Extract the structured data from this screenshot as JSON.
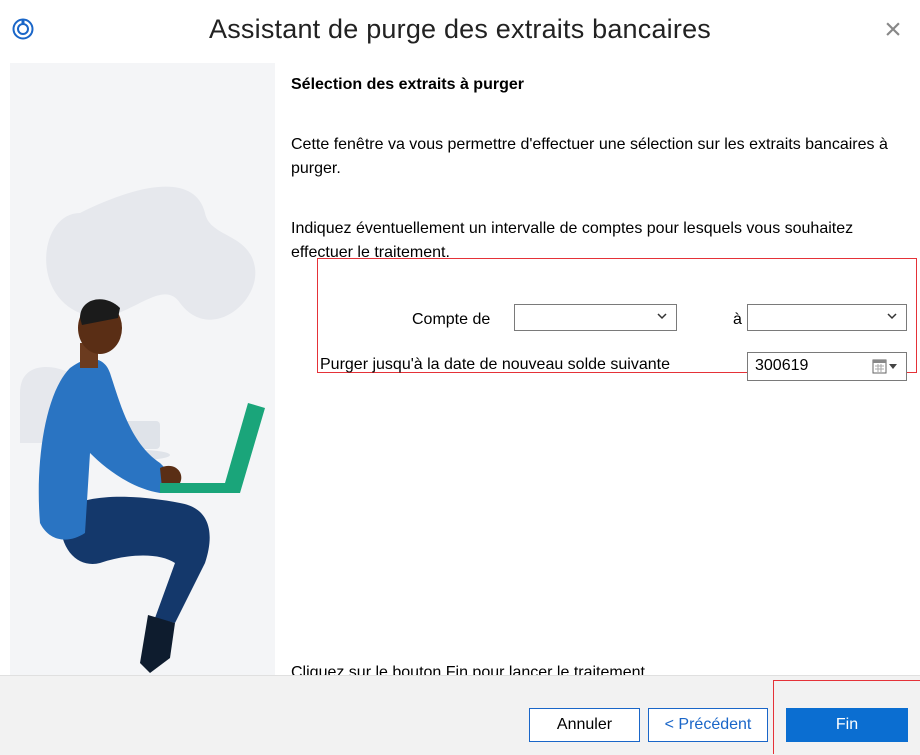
{
  "window": {
    "title": "Assistant de purge des extraits bancaires",
    "close_symbol": "×",
    "app_icon": "app-logo-icon",
    "close_icon": "close-icon"
  },
  "content": {
    "heading": "Sélection des extraits à purger",
    "intro": "Cette fenêtre va vous permettre d'effectuer une sélection sur les extraits bancaires à purger.",
    "instruction": "Indiquez éventuellement un intervalle de comptes pour lesquels vous souhaitez effectuer le traitement.",
    "final_instruction": "Cliquez sur le bouton Fin pour lancer le traitement."
  },
  "form": {
    "account_from_label": "Compte de",
    "account_from_value": "",
    "account_to_label": "à",
    "account_to_value": "",
    "purge_date_label": "Purger jusqu'à la date de nouveau solde suivante",
    "purge_date_value": "300619"
  },
  "buttons": {
    "cancel": "Annuler",
    "previous": "< Précédent",
    "finish": "Fin"
  },
  "colors": {
    "accent": "#0b6ed1",
    "highlight": "#e53238"
  }
}
